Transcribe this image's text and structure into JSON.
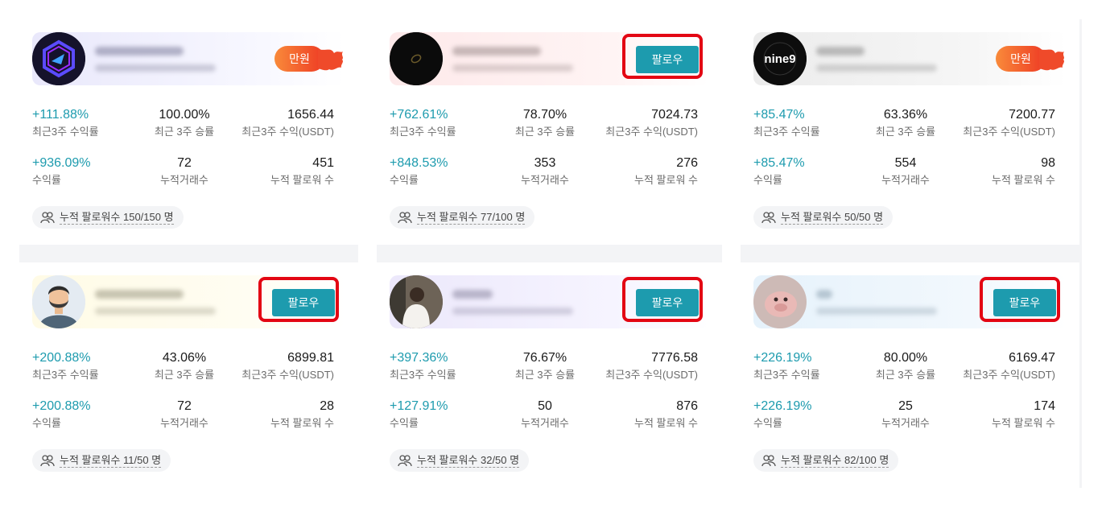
{
  "labels": {
    "recent_return": "최근3주 수익률",
    "recent_winrate": "최근 3주 승률",
    "recent_profit": "최근3주 수익(USDT)",
    "total_return": "수익률",
    "total_trades": "누적거래수",
    "total_followers": "누적 팔로워 수"
  },
  "follow_label": "팔로우",
  "hot_label": "만원",
  "colors": {
    "teal": "#1d9bae",
    "highlight": "#e30613",
    "badge": "#f05a2a"
  },
  "cards": [
    {
      "badge": "hot",
      "recent_return": "+111.88%",
      "recent_winrate": "100.00%",
      "recent_profit": "1656.44",
      "total_return": "+936.09%",
      "total_trades": "72",
      "total_followers": "451",
      "follower_status": "누적 팔로워수 150/150 명"
    },
    {
      "badge": "follow",
      "recent_return": "+762.61%",
      "recent_winrate": "78.70%",
      "recent_profit": "7024.73",
      "total_return": "+848.53%",
      "total_trades": "353",
      "total_followers": "276",
      "follower_status": "누적 팔로워수 77/100 명"
    },
    {
      "badge": "hot",
      "avatar_text": "nine9",
      "recent_return": "+85.47%",
      "recent_winrate": "63.36%",
      "recent_profit": "7200.77",
      "total_return": "+85.47%",
      "total_trades": "554",
      "total_followers": "98",
      "follower_status": "누적 팔로워수 50/50 명"
    },
    {
      "badge": "follow",
      "recent_return": "+200.88%",
      "recent_winrate": "43.06%",
      "recent_profit": "6899.81",
      "total_return": "+200.88%",
      "total_trades": "72",
      "total_followers": "28",
      "follower_status": "누적 팔로워수 11/50 명"
    },
    {
      "badge": "follow",
      "recent_return": "+397.36%",
      "recent_winrate": "76.67%",
      "recent_profit": "7776.58",
      "total_return": "+127.91%",
      "total_trades": "50",
      "total_followers": "876",
      "follower_status": "누적 팔로워수 32/50 명"
    },
    {
      "badge": "follow",
      "recent_return": "+226.19%",
      "recent_winrate": "80.00%",
      "recent_profit": "6169.47",
      "total_return": "+226.19%",
      "total_trades": "25",
      "total_followers": "174",
      "follower_status": "누적 팔로워수 82/100 명"
    }
  ]
}
